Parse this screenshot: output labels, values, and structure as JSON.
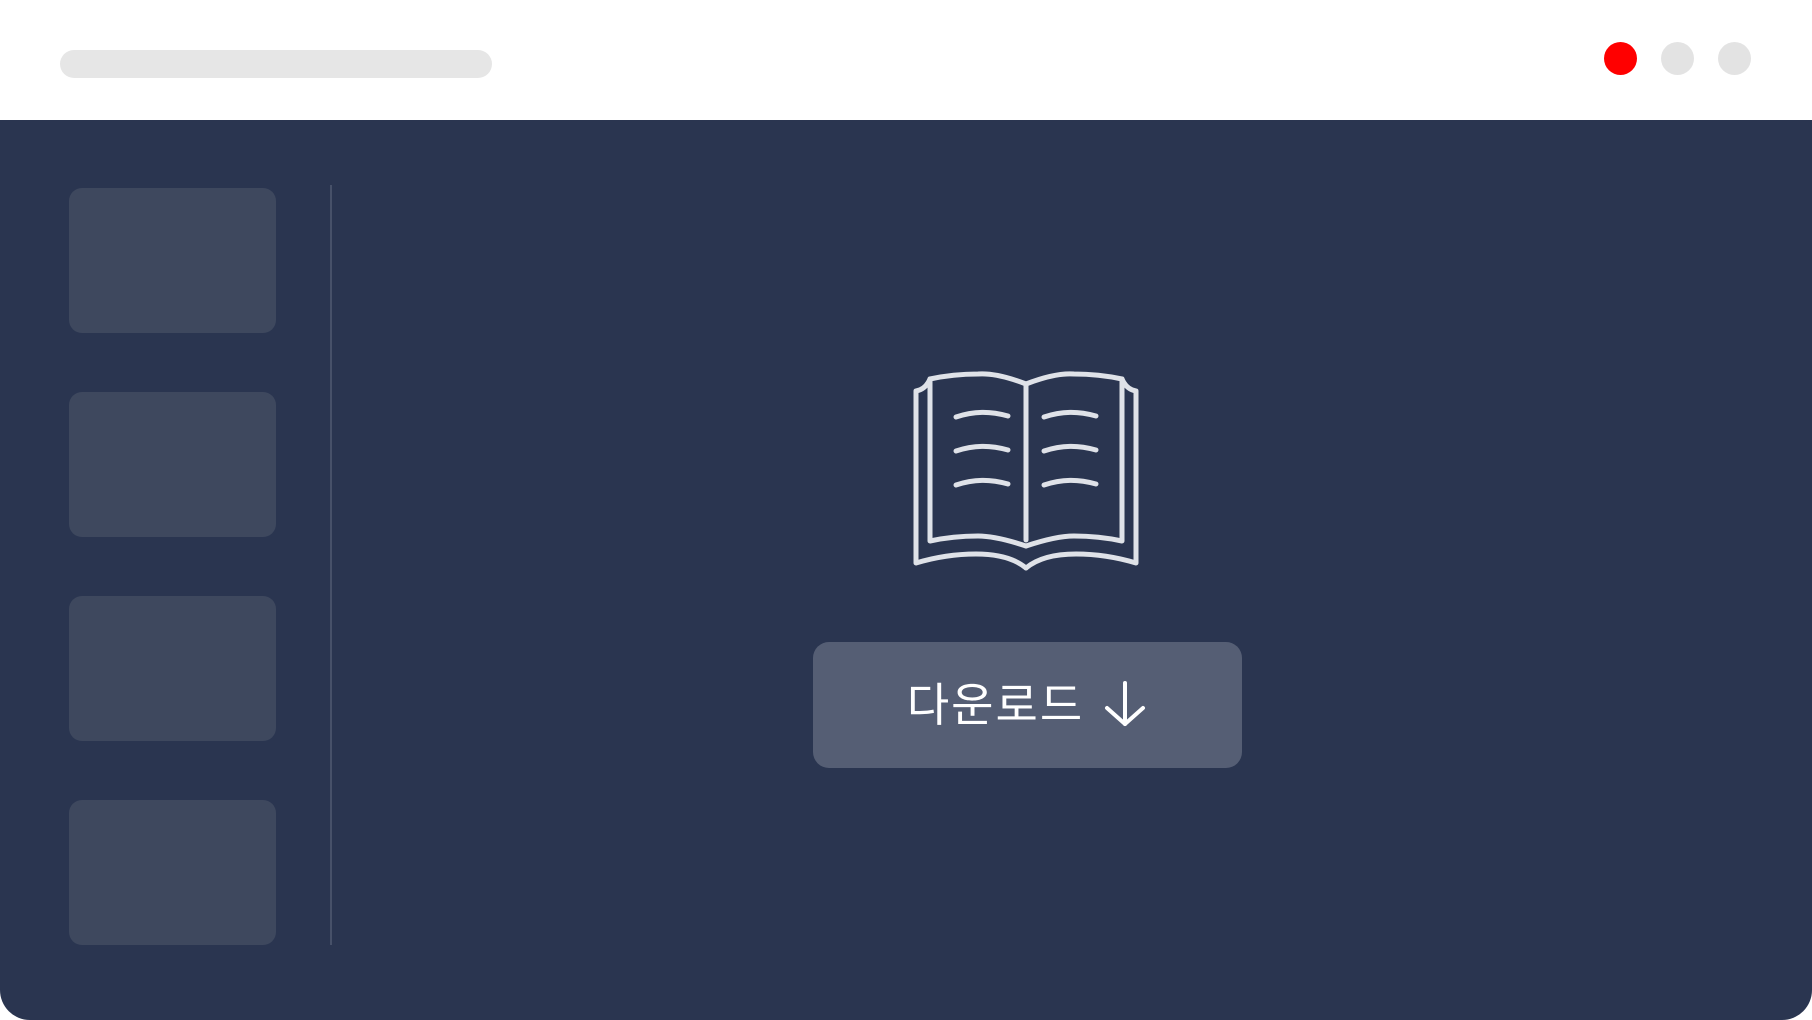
{
  "window": {
    "controls": [
      {
        "name": "close",
        "color": "#ff0000"
      },
      {
        "name": "minimize",
        "color": "#e3e3e3"
      },
      {
        "name": "maximize",
        "color": "#e3e3e3"
      }
    ],
    "address_bar": {
      "value": ""
    }
  },
  "sidebar": {
    "thumbnails": [
      {
        "label": ""
      },
      {
        "label": ""
      },
      {
        "label": ""
      },
      {
        "label": ""
      }
    ]
  },
  "main": {
    "icon": "open-book-icon",
    "download_button": {
      "label": "다운로드",
      "icon": "arrow-down-icon"
    }
  },
  "colors": {
    "background": "#2a3550",
    "thumbnail": "#3e485e",
    "button": "#555e74",
    "icon_stroke": "#dfe2e8",
    "accent_red": "#ff0000"
  }
}
